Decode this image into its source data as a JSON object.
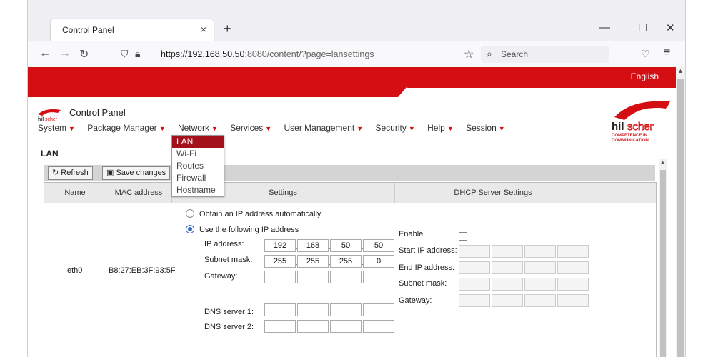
{
  "browser": {
    "tab_title": "Control Panel",
    "tab_close": "×",
    "new_tab": "+",
    "url_host": "https://192.168.50.50",
    "url_rest": ":8080/content/?page=lansettings",
    "search_placeholder": "Search",
    "minimize": "—",
    "maximize": "☐",
    "close": "✕"
  },
  "header": {
    "language": "English",
    "app_title": "Control Panel",
    "logo_text": "hilscher",
    "logo_tagline_1": "COMPETENCE IN",
    "logo_tagline_2": "COMMUNICATION"
  },
  "menu": {
    "items": [
      {
        "label": "System"
      },
      {
        "label": "Package Manager"
      },
      {
        "label": "Network"
      },
      {
        "label": "Services"
      },
      {
        "label": "User Management"
      },
      {
        "label": "Security"
      },
      {
        "label": "Help"
      },
      {
        "label": "Session"
      }
    ],
    "network_dropdown": [
      "LAN",
      "Wi-Fi",
      "Routes",
      "Firewall",
      "Hostname"
    ]
  },
  "section_title": "LAN",
  "toolbar": {
    "refresh_label": "Refresh",
    "save_label": "Save changes"
  },
  "table": {
    "headers": {
      "name": "Name",
      "mac": "MAC address",
      "settings": "Settings",
      "dhcp": "DHCP Server Settings"
    },
    "row": {
      "name": "eth0",
      "mac": "B8:27:EB:3F:93:5F",
      "opt_auto": "Obtain an IP address automatically",
      "opt_manual": "Use the following IP address",
      "ip_label": "IP address:",
      "ip": [
        "192",
        "168",
        "50",
        "50"
      ],
      "mask_label": "Subnet mask:",
      "mask": [
        "255",
        "255",
        "255",
        "0"
      ],
      "gateway_label": "Gateway:",
      "dns1_label": "DNS server 1:",
      "dns2_label": "DNS server 2:",
      "dhcp_enable_label": "Enable",
      "dhcp_start_label": "Start IP address:",
      "dhcp_end_label": "End IP address:",
      "dhcp_mask_label": "Subnet mask:",
      "dhcp_gateway_label": "Gateway:"
    }
  },
  "colors": {
    "brand_red": "#d40e13",
    "dropdown_selected": "#a3111a"
  }
}
